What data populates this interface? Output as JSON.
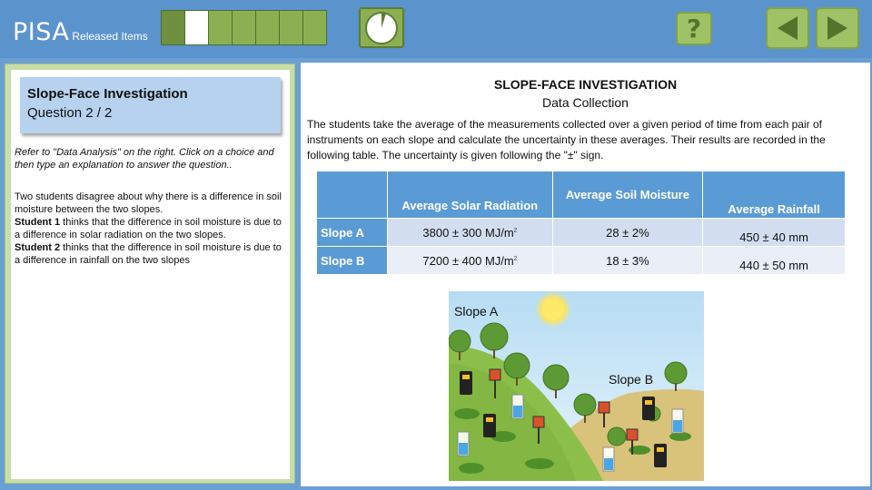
{
  "header": {
    "brand": "PISA",
    "brand_sub": "Released Items",
    "progress": {
      "total": 7,
      "current": 2,
      "completed": 1
    },
    "help_label": "?"
  },
  "left": {
    "title": "Slope-Face Investigation",
    "question": "Question 2 / 2",
    "instructions": "Refer to \"Data Analysis\" on the right. Click on a choice and then type an explanation to answer the question..",
    "scenario_intro": "Two students disagree about why there is a difference in soil moisture between the two slopes.",
    "student1_label": "Student 1",
    "student1_text": " thinks that the difference in soil moisture is due to a difference in solar radiation on the two slopes.",
    "student2_label": "Student 2",
    "student2_text": " thinks that the difference in soil moisture is due to a difference in rainfall on the two slopes"
  },
  "right": {
    "title": "SLOPE-FACE INVESTIGATION",
    "subtitle": "Data Collection",
    "paragraph": "The students take the average of the measurements collected over a given period of time from each pair of instruments on each slope and calculate the uncertainty in these averages. Their results are recorded in the following table. The uncertainty is given following the \"±\" sign.",
    "table": {
      "headers": [
        "",
        "Average Solar Radiation",
        "Average Soil Moisture",
        "Average Rainfall"
      ],
      "rows": [
        {
          "label": "Slope A",
          "solar": "3800 ± 300 MJ/m",
          "solar_sup": "2",
          "moisture": "28 ± 2%",
          "rainfall": "450 ± 40 mm"
        },
        {
          "label": "Slope B",
          "solar": "7200 ± 400 MJ/m",
          "solar_sup": "2",
          "moisture": "18 ± 3%",
          "rainfall": "440 ± 50 mm"
        }
      ]
    },
    "illustration": {
      "label_a": "Slope A",
      "label_b": "Slope B"
    }
  },
  "colors": {
    "header": "#5b93cd",
    "accent_green": "#8ab052",
    "table_header": "#5b9bd5"
  }
}
